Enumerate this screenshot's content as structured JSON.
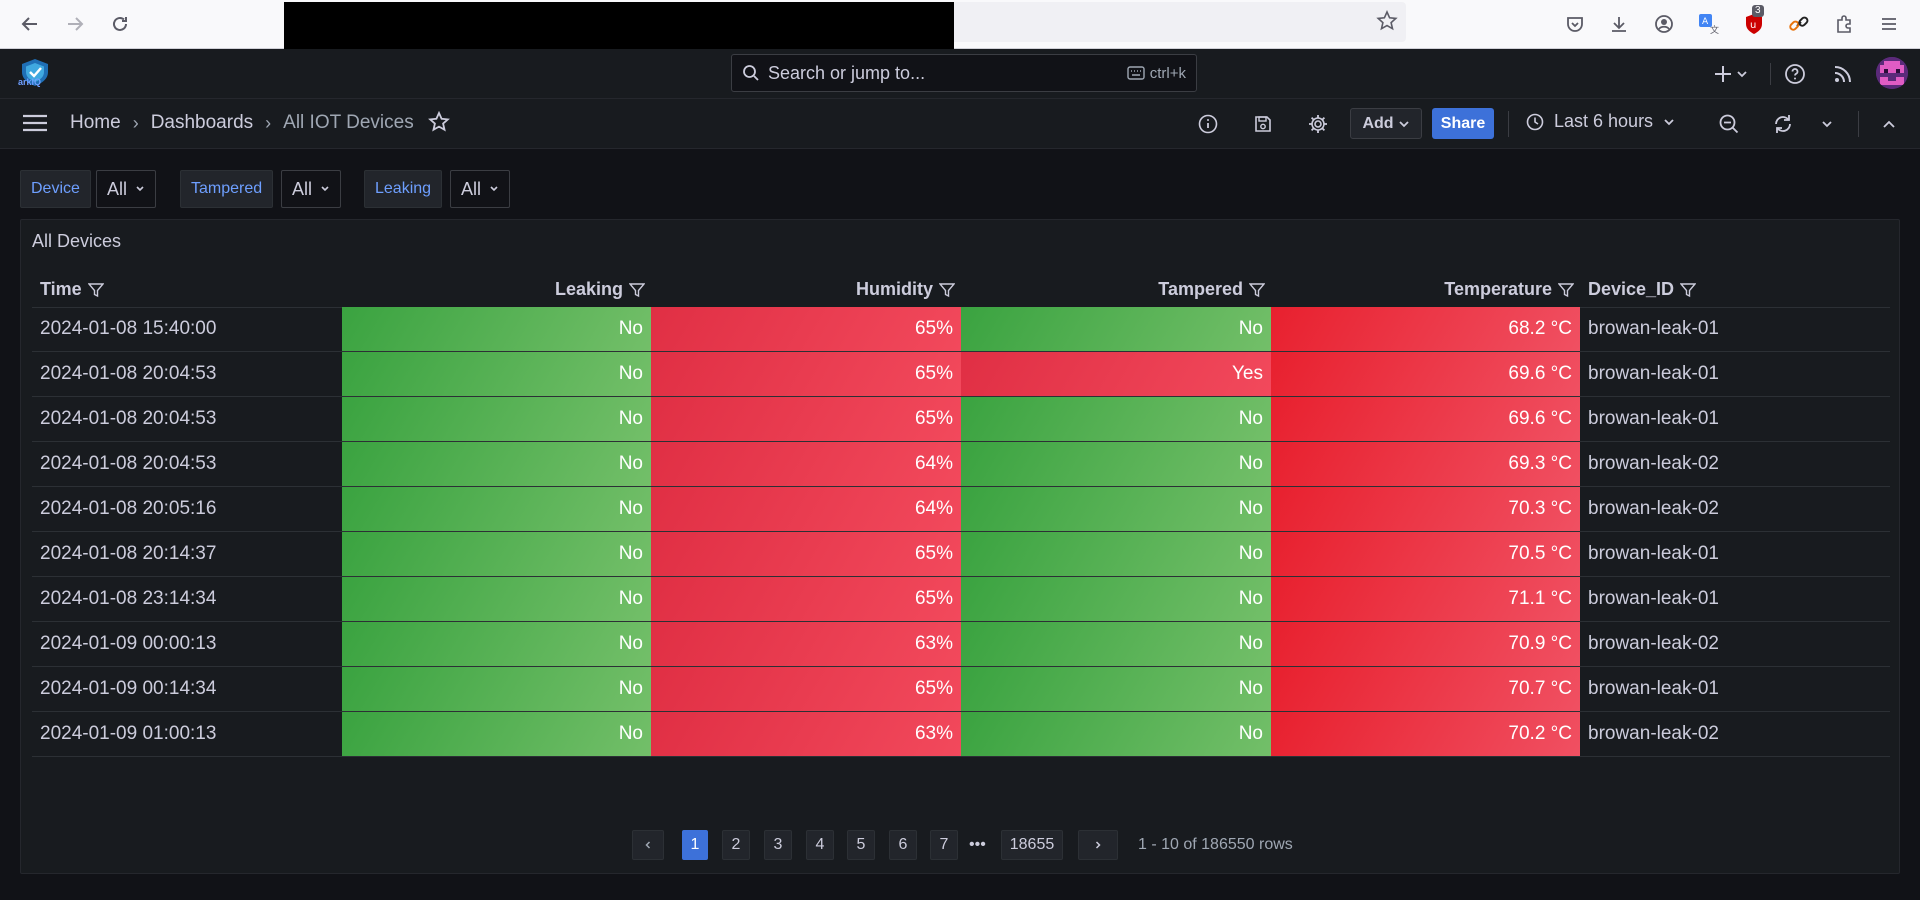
{
  "browser": {
    "badge_count": "3",
    "icons": [
      "back-icon",
      "forward-icon",
      "reload-icon",
      "bookmark-star-icon",
      "pocket-icon",
      "download-icon",
      "account-icon",
      "translate-icon",
      "ublock-icon",
      "link-icon",
      "extensions-icon",
      "menu-icon"
    ]
  },
  "topnav": {
    "logo_text": "arkIQ",
    "search_placeholder": "Search or jump to...",
    "search_shortcut": "ctrl+k"
  },
  "toolbar": {
    "breadcrumb": [
      "Home",
      "Dashboards",
      "All IOT Devices"
    ],
    "breadcrumb_sep": "›",
    "add_label": "Add",
    "share_label": "Share",
    "time_range": "Last 6 hours"
  },
  "variables": [
    {
      "label": "Device",
      "value": "All"
    },
    {
      "label": "Tampered",
      "value": "All"
    },
    {
      "label": "Leaking",
      "value": "All"
    }
  ],
  "panel": {
    "title": "All Devices",
    "columns": [
      "Time",
      "Leaking",
      "Humidity",
      "Tampered",
      "Temperature",
      "Device_ID"
    ],
    "rows": [
      {
        "time": "2024-01-08 15:40:00",
        "leaking": "No",
        "humidity": "65%",
        "tampered": "No",
        "temperature": "68.2 °C",
        "device": "browan-leak-01"
      },
      {
        "time": "2024-01-08 20:04:53",
        "leaking": "No",
        "humidity": "65%",
        "tampered": "Yes",
        "temperature": "69.6 °C",
        "device": "browan-leak-01"
      },
      {
        "time": "2024-01-08 20:04:53",
        "leaking": "No",
        "humidity": "65%",
        "tampered": "No",
        "temperature": "69.6 °C",
        "device": "browan-leak-01"
      },
      {
        "time": "2024-01-08 20:04:53",
        "leaking": "No",
        "humidity": "64%",
        "tampered": "No",
        "temperature": "69.3 °C",
        "device": "browan-leak-02"
      },
      {
        "time": "2024-01-08 20:05:16",
        "leaking": "No",
        "humidity": "64%",
        "tampered": "No",
        "temperature": "70.3 °C",
        "device": "browan-leak-02"
      },
      {
        "time": "2024-01-08 20:14:37",
        "leaking": "No",
        "humidity": "65%",
        "tampered": "No",
        "temperature": "70.5 °C",
        "device": "browan-leak-01"
      },
      {
        "time": "2024-01-08 23:14:34",
        "leaking": "No",
        "humidity": "65%",
        "tampered": "No",
        "temperature": "71.1 °C",
        "device": "browan-leak-01"
      },
      {
        "time": "2024-01-09 00:00:13",
        "leaking": "No",
        "humidity": "63%",
        "tampered": "No",
        "temperature": "70.9 °C",
        "device": "browan-leak-02"
      },
      {
        "time": "2024-01-09 00:14:34",
        "leaking": "No",
        "humidity": "65%",
        "tampered": "No",
        "temperature": "70.7 °C",
        "device": "browan-leak-01"
      },
      {
        "time": "2024-01-09 01:00:13",
        "leaking": "No",
        "humidity": "63%",
        "tampered": "No",
        "temperature": "70.2 °C",
        "device": "browan-leak-02"
      }
    ],
    "pagination": {
      "pages": [
        "1",
        "2",
        "3",
        "4",
        "5",
        "6",
        "7"
      ],
      "ellipsis": "•••",
      "last_page": "18655",
      "active_page": "1",
      "summary": "1 - 10 of 186550 rows"
    }
  },
  "colors": {
    "ok": "#73bf69",
    "bad": "#f2495c",
    "accent": "#3d71d9",
    "background": "#111217"
  }
}
